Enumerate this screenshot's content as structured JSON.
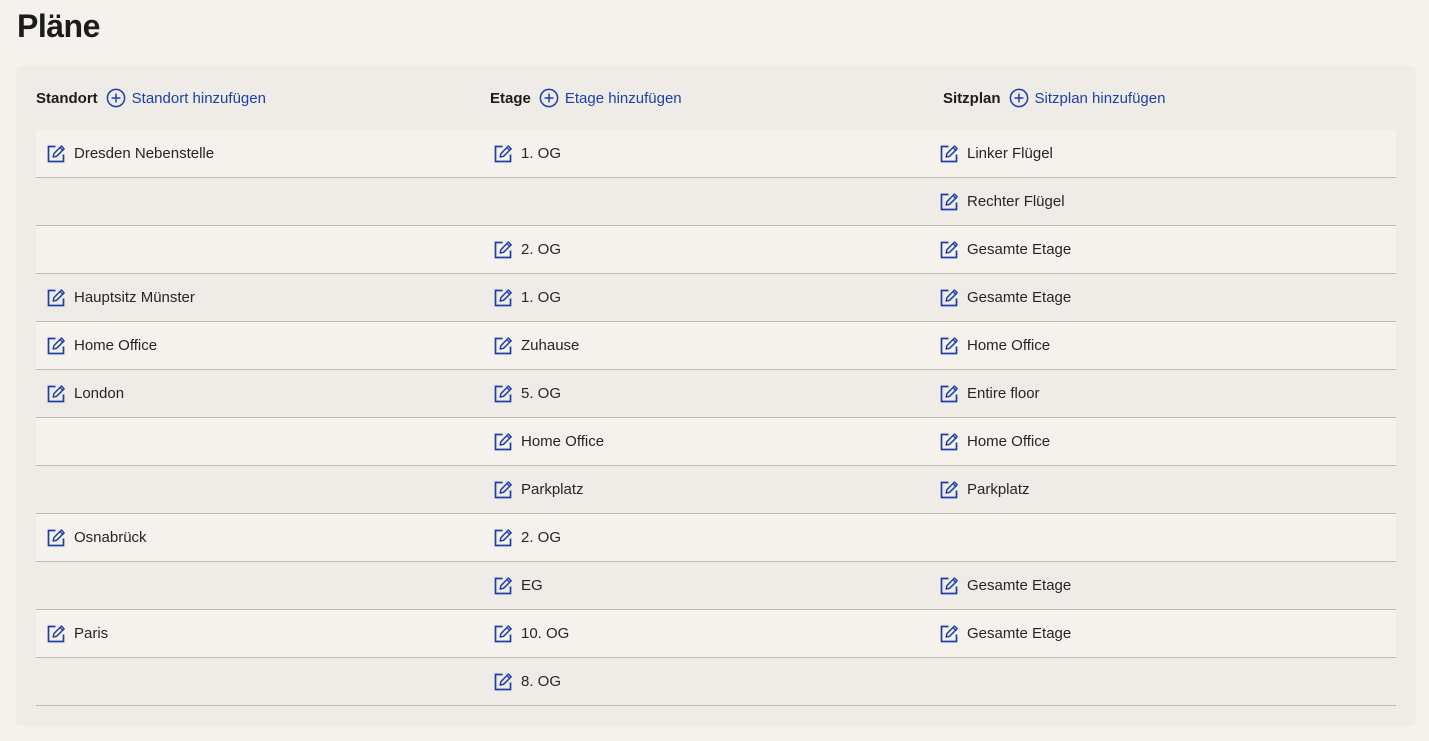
{
  "page": {
    "title": "Pläne"
  },
  "columns": {
    "standort": {
      "label": "Standort",
      "add_label": "Standort hinzufügen"
    },
    "etage": {
      "label": "Etage",
      "add_label": "Etage hinzufügen"
    },
    "sitzplan": {
      "label": "Sitzplan",
      "add_label": "Sitzplan hinzufügen"
    }
  },
  "icons": {
    "add": "plus-circle-icon",
    "edit": "edit-pencil-icon"
  },
  "colors": {
    "accent": "#1e3fa8",
    "background": "#f5f1ed",
    "panel": "#efebe6"
  },
  "rows": [
    {
      "standort": "Dresden Nebenstelle",
      "etage": "1. OG",
      "sitzplan": "Linker Flügel"
    },
    {
      "standort": "",
      "etage": "",
      "sitzplan": "Rechter Flügel"
    },
    {
      "standort": "",
      "etage": "2. OG",
      "sitzplan": "Gesamte Etage"
    },
    {
      "standort": "Hauptsitz Münster",
      "etage": "1. OG",
      "sitzplan": "Gesamte Etage"
    },
    {
      "standort": "Home Office",
      "etage": "Zuhause",
      "sitzplan": "Home Office"
    },
    {
      "standort": "London",
      "etage": "5. OG",
      "sitzplan": "Entire floor"
    },
    {
      "standort": "",
      "etage": "Home Office",
      "sitzplan": "Home Office"
    },
    {
      "standort": "",
      "etage": "Parkplatz",
      "sitzplan": "Parkplatz"
    },
    {
      "standort": "Osnabrück",
      "etage": "2. OG",
      "sitzplan": ""
    },
    {
      "standort": "",
      "etage": "EG",
      "sitzplan": "Gesamte Etage"
    },
    {
      "standort": "Paris",
      "etage": "10. OG",
      "sitzplan": "Gesamte Etage"
    },
    {
      "standort": "",
      "etage": "8. OG",
      "sitzplan": ""
    }
  ]
}
